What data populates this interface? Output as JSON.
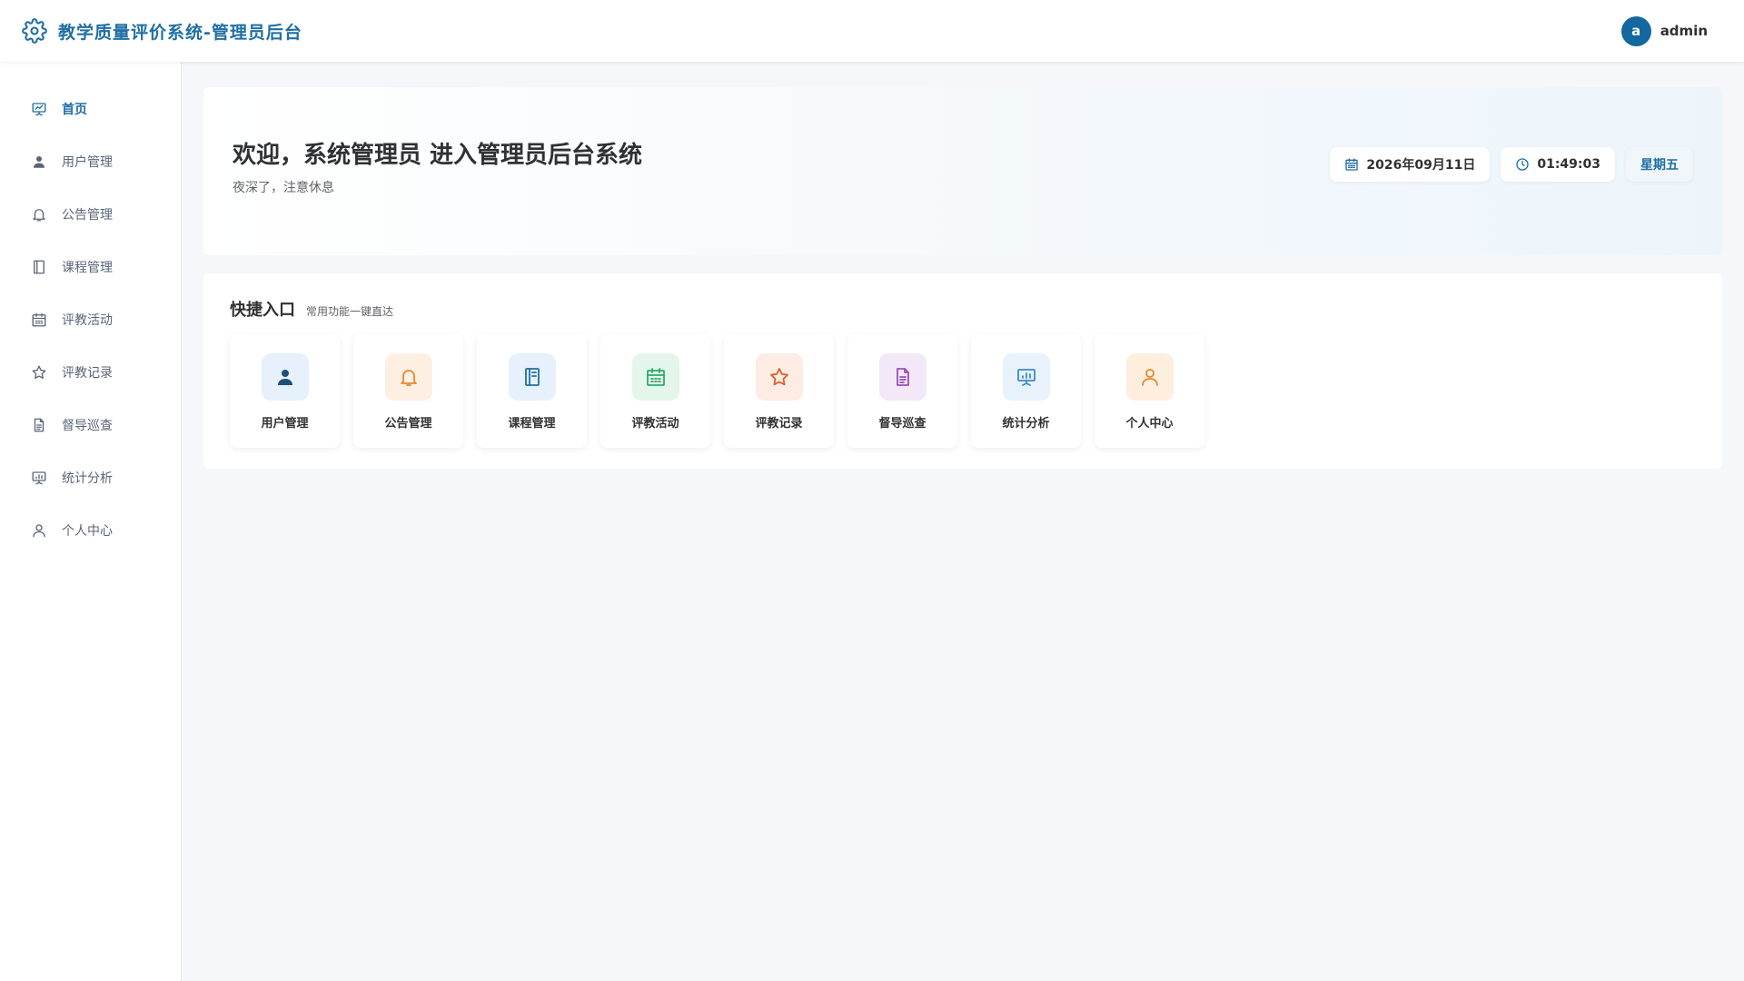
{
  "header": {
    "title": "教学质量评价系统-管理员后台",
    "brand_icon": "gear-icon",
    "user": {
      "avatar_letter": "a",
      "name": "admin"
    }
  },
  "sidebar": {
    "items": [
      {
        "label": "首页",
        "icon": "presentation-chart-icon",
        "active": true
      },
      {
        "label": "用户管理",
        "icon": "user-icon"
      },
      {
        "label": "公告管理",
        "icon": "bell-icon"
      },
      {
        "label": "课程管理",
        "icon": "notebook-icon"
      },
      {
        "label": "评教活动",
        "icon": "calendar-icon"
      },
      {
        "label": "评教记录",
        "icon": "star-icon"
      },
      {
        "label": "督导巡查",
        "icon": "document-icon"
      },
      {
        "label": "统计分析",
        "icon": "presentation-chart-icon"
      },
      {
        "label": "个人中心",
        "icon": "user-outline-icon"
      }
    ]
  },
  "welcome": {
    "title": "欢迎，系统管理员 进入管理员后台系统",
    "subtitle": "夜深了，注意休息",
    "date": "2026年09月11日",
    "time": "01:49:03",
    "weekday": "星期五"
  },
  "quick": {
    "title": "快捷入口",
    "subtitle": "常用功能一键直达",
    "cards": [
      {
        "label": "用户管理",
        "icon": "user-icon",
        "bg": "#e6f1fb",
        "color": "#1f4e79"
      },
      {
        "label": "公告管理",
        "icon": "bell-icon",
        "bg": "#fdf0e3",
        "color": "#e6862e"
      },
      {
        "label": "课程管理",
        "icon": "notebook-icon",
        "bg": "#e6f1fb",
        "color": "#1f6fa3"
      },
      {
        "label": "评教活动",
        "icon": "calendar-icon",
        "bg": "#e4f6ec",
        "color": "#2ea96a"
      },
      {
        "label": "评教记录",
        "icon": "star-icon",
        "bg": "#fcece4",
        "color": "#d9622b"
      },
      {
        "label": "督导巡查",
        "icon": "document-icon",
        "bg": "#f3e8f7",
        "color": "#9c4dbb"
      },
      {
        "label": "统计分析",
        "icon": "presentation-chart-icon",
        "bg": "#e8f2fb",
        "color": "#3a8bc9"
      },
      {
        "label": "个人中心",
        "icon": "user-outline-icon",
        "bg": "#fdeedd",
        "color": "#e28a2b"
      }
    ]
  },
  "colors": {
    "primary": "#1f6fa3",
    "avatar": "#14679f",
    "page_bg": "#f5f7fa"
  }
}
